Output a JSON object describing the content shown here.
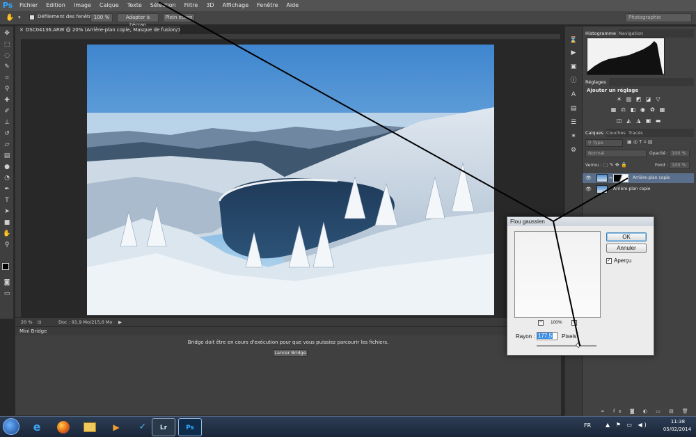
{
  "menu": {
    "logo": "Ps",
    "items": [
      "Fichier",
      "Edition",
      "Image",
      "Calque",
      "Texte",
      "Sélection",
      "Filtre",
      "3D",
      "Affichage",
      "Fenêtre",
      "Aide"
    ]
  },
  "options_bar": {
    "scroll_all_label": "Défilement des fenêtres",
    "zoom_100_label": "100 %",
    "fit_screen_label": "Adapter à l'écran",
    "full_screen_label": "Plein écran",
    "workspace": "Photographie"
  },
  "document": {
    "tab_title": "DSC04136.ARW @ 20% (Arrière-plan copie, Masque de fusion/16) *",
    "zoom": "20 %",
    "doc_info": "Doc : 91,9 Mo/215,6 Mo"
  },
  "mini_bridge": {
    "tab": "Mini Bridge",
    "message": "Bridge doit être en cours d'exécution pour que vous puissiez parcourir les fichiers.",
    "launch_button": "Lancer Bridge"
  },
  "panels": {
    "histogram_tab": "Histogramme",
    "navigation_tab": "Navigation",
    "adjustments_tab": "Réglages",
    "add_adjustment": "Ajouter un réglage",
    "layers_tab": "Calques",
    "channels_tab": "Couches",
    "paths_tab": "Tracés",
    "filter_type": "Type",
    "blend_mode": "Normal",
    "opacity_label": "Opacité :",
    "opacity_value": "100 %",
    "lock_label": "Verrou :",
    "fill_label": "Fond :",
    "fill_value": "100 %",
    "layers": [
      {
        "name": "Arrière-plan copie"
      },
      {
        "name": "Arrière-plan copie"
      }
    ]
  },
  "dialog": {
    "title": "Flou gaussien",
    "ok_button": "OK",
    "cancel_button": "Annuler",
    "preview_label": "Aperçu",
    "preview_checked": true,
    "zoom_level": "100%",
    "radius_label": "Rayon :",
    "radius_value": "177,5",
    "unit": "Pixels"
  },
  "taskbar": {
    "lang": "FR",
    "time": "11:38",
    "date": "05/02/2014",
    "apps": [
      {
        "label": "e",
        "icon": "internet-explorer-icon"
      },
      {
        "label": "",
        "icon": "firefox-icon"
      },
      {
        "label": "",
        "icon": "file-explorer-icon"
      },
      {
        "label": "",
        "icon": "media-player-icon"
      },
      {
        "label": "",
        "icon": "app-icon"
      },
      {
        "label": "Lr",
        "icon": "lightroom-icon"
      },
      {
        "label": "Ps",
        "icon": "photoshop-icon"
      }
    ]
  },
  "colors": {
    "accent": "#31a8ff",
    "selection": "#3a8ee6"
  }
}
